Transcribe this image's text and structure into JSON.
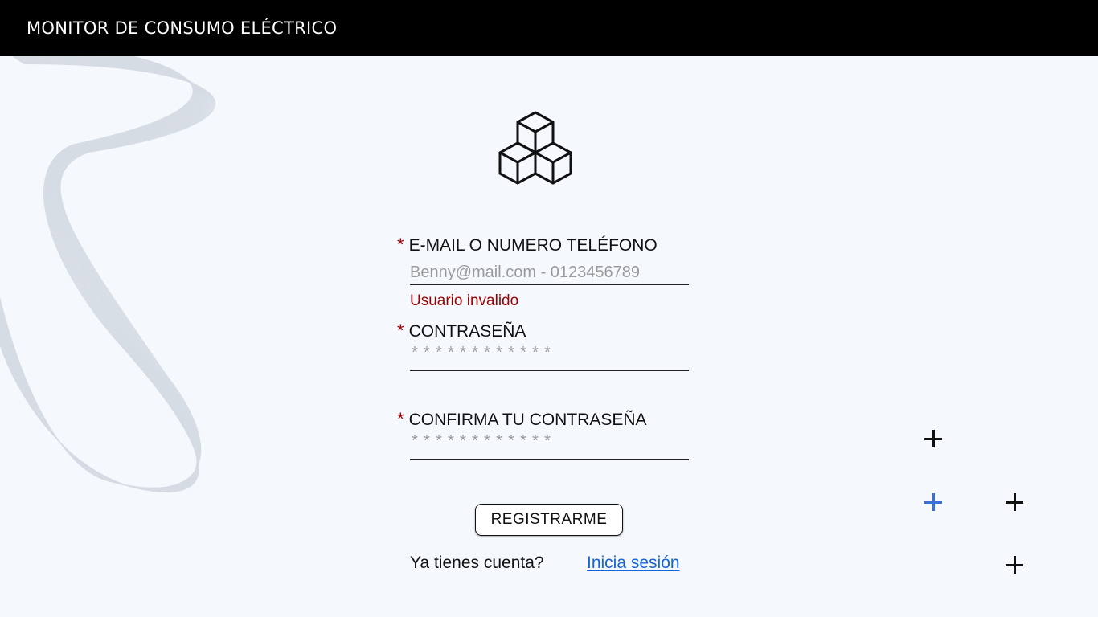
{
  "header": {
    "title": "MONITOR DE CONSUMO ELÉCTRICO"
  },
  "logo": {
    "icon": "cubes-icon"
  },
  "form": {
    "required_mark": "*",
    "email": {
      "label": "E-MAIL O NUMERO TELÉFONO",
      "placeholder": "Benny@mail.com - 0123456789",
      "error": "Usuario invalido"
    },
    "password": {
      "label": "CONTRASEÑA",
      "masked": "************"
    },
    "confirm_password": {
      "label": "CONFIRMA TU CONTRASEÑA",
      "masked": "************"
    },
    "submit_label": "REGISTRARME"
  },
  "footer": {
    "question": "Ya tienes cuenta?",
    "login_link": "Inicia sesión"
  },
  "colors": {
    "header_bg": "#000000",
    "page_bg": "#f5f8fd",
    "error": "#9b0000",
    "link": "#1565d8",
    "plus_accent": "#3b6fd6"
  },
  "decor": {
    "plus_icons": [
      "plus-icon",
      "plus-icon-blue",
      "plus-icon",
      "plus-icon"
    ]
  }
}
